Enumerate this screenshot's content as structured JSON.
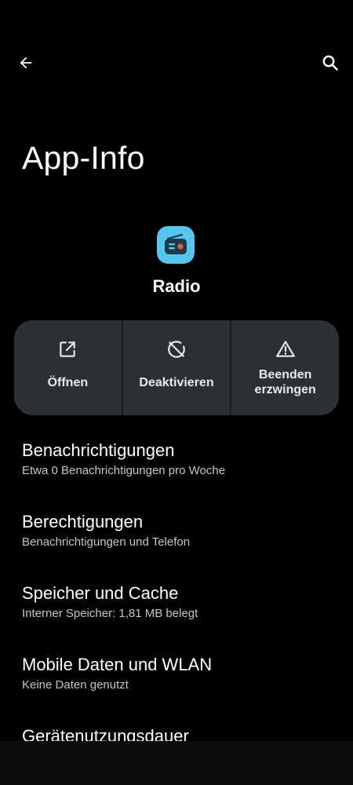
{
  "header": {
    "back_icon": "arrow-left-icon",
    "search_icon": "search-icon",
    "title": "App-Info"
  },
  "app": {
    "icon": "radio-icon",
    "name": "Radio",
    "icon_color": "#57c4ef"
  },
  "actions": [
    {
      "icon": "open-external-icon",
      "label": "Öffnen"
    },
    {
      "icon": "disable-icon",
      "label": "Deaktivieren"
    },
    {
      "icon": "warning-icon",
      "label": "Beenden erzwingen"
    }
  ],
  "settings": [
    {
      "title": "Benachrichtigungen",
      "subtitle": "Etwa 0 Benachrichtigungen pro Woche"
    },
    {
      "title": "Berechtigungen",
      "subtitle": "Benachrichtigungen und Telefon"
    },
    {
      "title": "Speicher und Cache",
      "subtitle": "Interner Speicher: 1,81 MB belegt"
    },
    {
      "title": "Mobile Daten und WLAN",
      "subtitle": "Keine Daten genutzt"
    },
    {
      "title": "Gerätenutzungsdauer",
      "subtitle": ""
    }
  ]
}
